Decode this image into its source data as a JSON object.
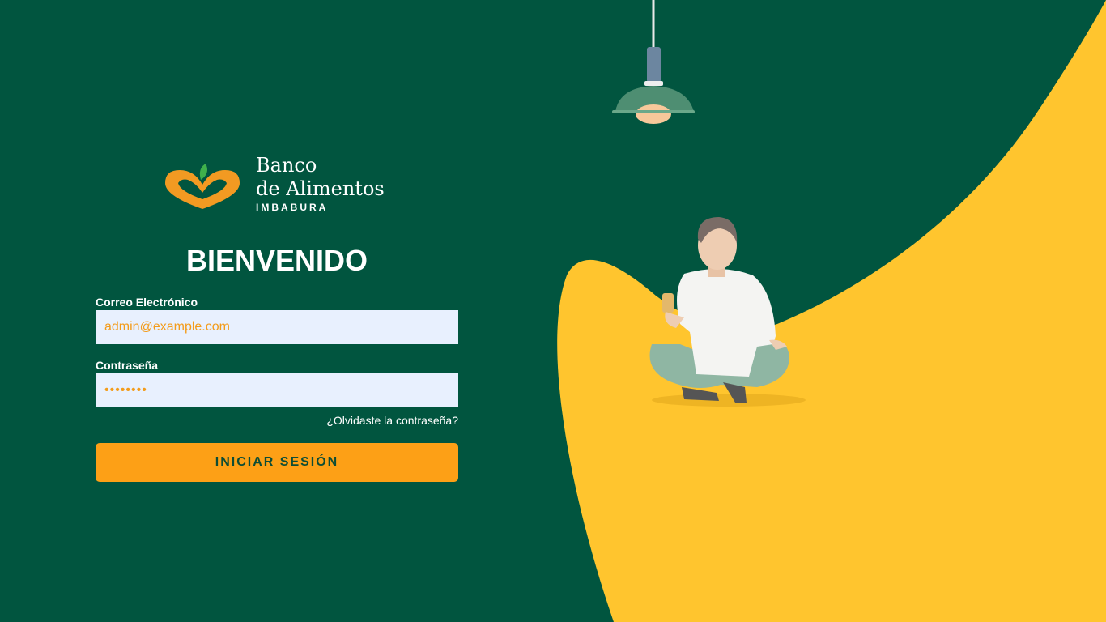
{
  "brand": {
    "line1": "Banco",
    "line2": "de Alimentos",
    "line3": "IMBABURA"
  },
  "login": {
    "title": "BIENVENIDO",
    "email_label": "Correo Electrónico",
    "email_value": "admin@example.com",
    "password_label": "Contraseña",
    "password_value": "12345678",
    "forgot_link": "¿Olvidaste la contraseña?",
    "submit_label": "INICIAR SESIÓN"
  },
  "colors": {
    "background": "#01553F",
    "accent_yellow": "#FFC52E",
    "button": "#FDA016",
    "button_text": "#0E4D35",
    "input_bg": "#E8F0FE",
    "input_text": "#F39C1B"
  },
  "illustration": {
    "lamp_icon": "pendant-lamp",
    "person_icon": "person-sitting-with-phone"
  }
}
